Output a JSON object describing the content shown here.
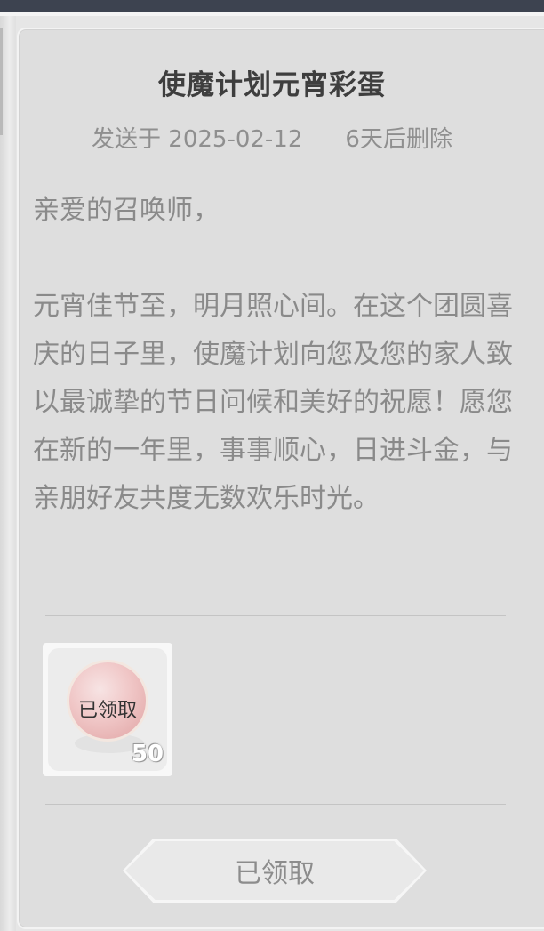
{
  "mail": {
    "title": "使魔计划元宵彩蛋",
    "sent_date": "发送于 2025-02-12",
    "expiry": "6天后删除",
    "body": "亲爱的召唤师，\n\n元宵佳节至，明月照心间。在这个团圆喜庆的日子里，使魔计划向您及您的家人致以最诚挚的节日问候和美好的祝愿！愿您在新的一年里，事事顺心，日进斗金，与亲朋好友共度无数欢乐时光。"
  },
  "attachment": {
    "status_label": "已领取",
    "count": "50",
    "icon": "crystal-orb-icon"
  },
  "claim_button": {
    "label": "已领取"
  },
  "colors": {
    "topbar": "#3d4350",
    "card_bg": "#dedede",
    "title": "#3e3e3e",
    "body_text": "#8a8a8a"
  }
}
